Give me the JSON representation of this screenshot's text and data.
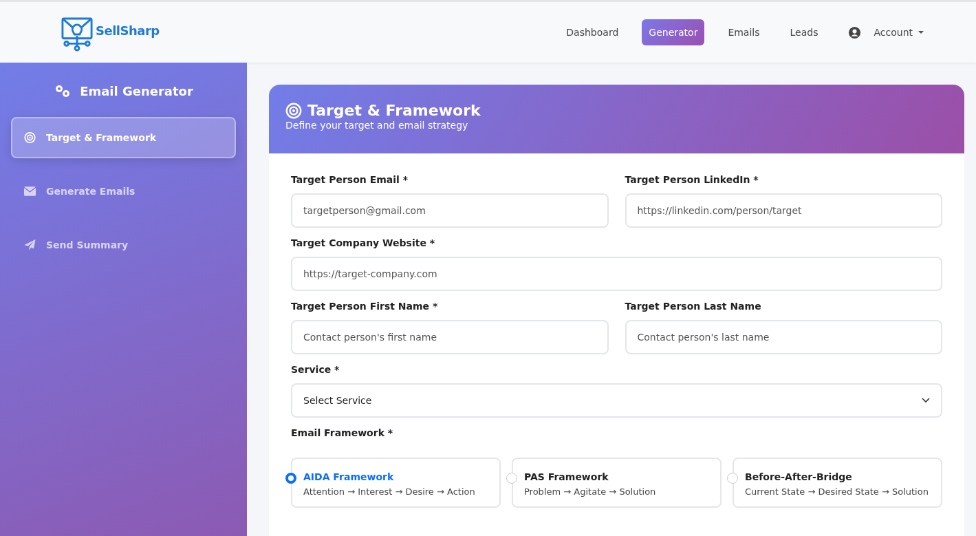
{
  "brand": {
    "name": "SellSharp"
  },
  "nav": [
    {
      "label": "Dashboard",
      "selected": false
    },
    {
      "label": "Generator",
      "selected": true
    },
    {
      "label": "Emails",
      "selected": false
    },
    {
      "label": "Leads",
      "selected": false
    }
  ],
  "account": {
    "label": "Account"
  },
  "sidebar": {
    "title": "Email Generator",
    "items": [
      {
        "label": "Target & Framework",
        "kind": "target",
        "selected": true
      },
      {
        "label": "Generate Emails",
        "kind": "envelope",
        "selected": false
      },
      {
        "label": "Send Summary",
        "kind": "send",
        "selected": false
      }
    ]
  },
  "card": {
    "title": "Target & Framework",
    "subtitle": "Define your target and email strategy"
  },
  "form": {
    "rows": [
      [
        {
          "label": "Target Person Email *",
          "placeholder": "targetperson@gmail.com",
          "kind": "input"
        },
        {
          "label": "Target Person LinkedIn *",
          "placeholder": "https://linkedin.com/person/target",
          "kind": "input"
        }
      ],
      [
        {
          "label": "Target Company Website *",
          "placeholder": "https://target-company.com",
          "kind": "input"
        }
      ],
      [
        {
          "label": "Target Person First Name *",
          "placeholder": "Contact person's first name",
          "kind": "input"
        },
        {
          "label": "Target Person Last Name",
          "placeholder": "Contact person's last name",
          "kind": "input"
        }
      ],
      [
        {
          "label": "Service *",
          "value": "Select Service",
          "kind": "select"
        }
      ]
    ]
  },
  "frameworks": {
    "label": "Email Framework *",
    "options": [
      {
        "title": "AIDA Framework",
        "description": "Attention → Interest → Desire → Action",
        "selected": true
      },
      {
        "title": "PAS Framework",
        "description": "Problem → Agitate → Solution",
        "selected": false
      },
      {
        "title": "Before-After-Bridge",
        "description": "Current State → Desired State → Solution",
        "selected": false
      }
    ]
  }
}
